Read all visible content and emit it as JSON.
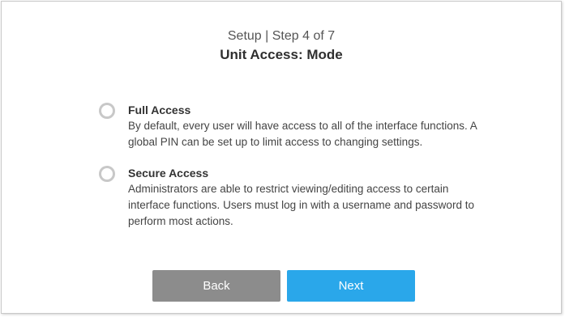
{
  "header": {
    "step_text": "Setup | Step 4 of 7",
    "title": "Unit Access: Mode"
  },
  "options": [
    {
      "title": "Full Access",
      "description": "By default, every user will have access to all of the interface functions. A global PIN can be set up to limit access to changing settings.",
      "selected": false
    },
    {
      "title": "Secure Access",
      "description": "Administrators are able to restrict viewing/editing access to certain interface functions. Users must log in with a username and password to perform most actions.",
      "selected": false
    }
  ],
  "buttons": {
    "back_label": "Back",
    "next_label": "Next"
  },
  "colors": {
    "back_button": "#8c8c8c",
    "next_button": "#2aa7ea",
    "radio_border": "#c8c8c8"
  }
}
